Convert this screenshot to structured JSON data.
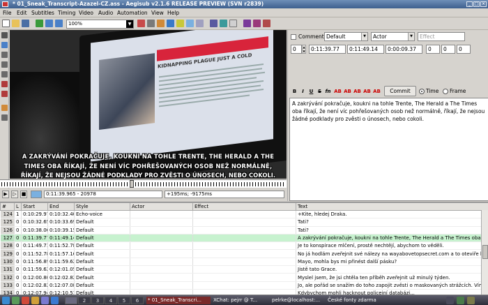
{
  "window": {
    "title": "* 01_Sneak_Transcript-Azazel-CZ.ass - Aegisub v2.1.6 RELEASE PREVIEW (SVN r2839)"
  },
  "menu": [
    "File",
    "Edit",
    "Subtitles",
    "Timing",
    "Video",
    "Audio",
    "Automation",
    "View",
    "Help"
  ],
  "toolbar": {
    "zoom": "100%"
  },
  "video": {
    "article_head": "KIDNAPPING PLAGUE JUST A COLD",
    "subtitle_line1": "A ZAKRÝVÁNÍ POKRAČUJE, KOUKNI NA TOHLE TRENTE, THE HERALD A THE",
    "subtitle_line2": "TIMES OBA ŘÍKAJÍ, ŽE NENÍ VÍC POHŘEŠOVANÝCH OSOB NEŽ NORMÁLNĚ,",
    "subtitle_line3": "ŘÍKAJÍ, ŽE NEJSOU ŽÁDNÉ PODKLADY PRO ZVĚSTI O ÚNOSECH, NEBO COKOLI.",
    "timecode": "0:11:39.965 - 20978",
    "offset": "+195ms; -9175ms"
  },
  "edit": {
    "comment_label": "Comment",
    "style": "Default",
    "actor": "Actor",
    "effect_placeholder": "Effect",
    "layer": "0",
    "start": "0:11:39.77",
    "end": "0:11:49.14",
    "duration": "0:00:09.37",
    "margin_l": "0",
    "margin_r": "0",
    "margin_v": "0",
    "commit": "Commit",
    "time_label": "Time",
    "frame_label": "Frame",
    "text": "A zakrývání pokračuje, koukni na tohle Trente, The Herald a The Times oba říkají, že není víc pohřešovaných osob než normálně, říkají, že nejsou žádné podklady pro zvěsti o únosech, nebo cokoli."
  },
  "grid": {
    "headers": [
      "#",
      "L",
      "Start",
      "End",
      "Style",
      "Actor",
      "Effect",
      "Text"
    ],
    "rows": [
      {
        "n": "124",
        "l": "1",
        "start": "0:10:29.97",
        "end": "0:10:32.40",
        "style": "Echo-voice",
        "actor": "",
        "effect": "",
        "text": "+Kite, hledej Draka."
      },
      {
        "n": "125",
        "l": "0",
        "start": "0:10:32.65",
        "end": "0:10:33.69",
        "style": "Default",
        "actor": "",
        "effect": "",
        "text": "Tati?"
      },
      {
        "n": "126",
        "l": "0",
        "start": "0:10:38.06",
        "end": "0:10:39.15",
        "style": "Default",
        "actor": "",
        "effect": "",
        "text": "Tati?"
      },
      {
        "n": "127",
        "l": "0",
        "start": "0:11:39.77",
        "end": "0:11:49.14",
        "style": "Default",
        "actor": "",
        "effect": "",
        "text": "A zakrývání pokračuje, koukni na tohle Trente, The Herald a The Times oba říkají, že ne"
      },
      {
        "n": "128",
        "l": "0",
        "start": "0:11:49.71",
        "end": "0:11:52.78",
        "style": "Default",
        "actor": "",
        "effect": "",
        "text": "Je to konspirace mlčení, prostě nechtějí, abychom to věděli."
      },
      {
        "n": "129",
        "l": "0",
        "start": "0:11:52.78",
        "end": "0:11:57.16",
        "style": "Default",
        "actor": "",
        "effect": "",
        "text": "No já hodlám zveřejnit své nálezy na wayabovetopsecret.com a to oteviře lidem oči."
      },
      {
        "n": "130",
        "l": "0",
        "start": "0:11:56.89",
        "end": "0:11:59.62",
        "style": "Default",
        "actor": "",
        "effect": "",
        "text": "Mayo, mohla bys mi přinést další pásku?"
      },
      {
        "n": "131",
        "l": "0",
        "start": "0:11:59.62",
        "end": "0:12:01.05",
        "style": "Default",
        "actor": "",
        "effect": "",
        "text": "Jistě tato Grace."
      },
      {
        "n": "132",
        "l": "0",
        "start": "0:12:00.80",
        "end": "0:12:02.82",
        "style": "Default",
        "actor": "",
        "effect": "",
        "text": "Myslel jsem, že jsi chtěla ten příběh zveřejnit už minulý týden."
      },
      {
        "n": "133",
        "l": "0",
        "start": "0:12:02.82",
        "end": "0:12:07.08",
        "style": "Default",
        "actor": "",
        "effect": "",
        "text": "Jo, ale pořád se snažím do toho zapojit zvěsti o maskovaných strážcích. Vím, že jsou s"
      },
      {
        "n": "134",
        "l": "0",
        "start": "0:12:07.94",
        "end": "0:12:10.51",
        "style": "Default",
        "actor": "",
        "effect": "",
        "text": "Kdybychom mohli hacknout policejní databázi..."
      },
      {
        "n": "135",
        "l": "0",
        "start": "0:12:10.19",
        "end": "0:12:11.21",
        "style": "Default",
        "actor": "",
        "effect": "",
        "text": "Mayo..."
      }
    ]
  },
  "taskbar": {
    "desktops": [
      "2",
      "3",
      "4",
      "5",
      "6"
    ],
    "tasks": [
      "* 01_Sneak_Transcri...",
      "XChat: pejrr @ T...",
      "pelrke@localhost:...",
      "České fonty zdarma"
    ]
  },
  "colors": {
    "title_bar": "#3d5f8e",
    "selected_row": "#c7f2cf",
    "subtitle_red": "#d8243b"
  }
}
